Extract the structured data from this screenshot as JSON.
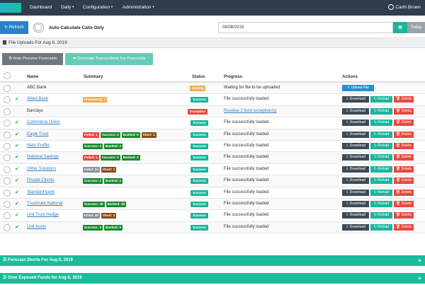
{
  "nav": {
    "items": [
      "Dashboard",
      "Daily",
      "Configuration",
      "Administration"
    ],
    "user": "Carth Brown"
  },
  "toolbar": {
    "refresh_label": "Refresh",
    "auto_calc_label": "Auto Calculate Calls Only",
    "date_value": "08/08/2019",
    "today_label": "Today"
  },
  "section": {
    "title": "File Uploads For Aug 8, 2019",
    "btn_auto": "Auto Process Forecasts",
    "btn_generate": "Generate Transactions For Forecasts"
  },
  "table": {
    "headers": [
      "Name",
      "Summary",
      "Status",
      "Progress",
      "Actions"
    ],
    "rows": [
      {
        "name": "ABC Bank",
        "link": false,
        "check": false,
        "badges": [],
        "status": "Waiting",
        "status_color": "#f0ad4e",
        "progress": "Waiting for file to be uploaded",
        "progress_link": false,
        "actions": [
          "Upload File"
        ]
      },
      {
        "name": "Allied Bank",
        "link": true,
        "check": true,
        "badges": [
          {
            "t": "Processing: 1",
            "c": "#f0ad4e"
          }
        ],
        "status": "Success",
        "status_color": "#1bb59a",
        "progress": "File successfully loaded",
        "progress_link": false,
        "actions": [
          "Download",
          "Reload",
          "Delete"
        ]
      },
      {
        "name": "Barclays",
        "link": false,
        "check": false,
        "badges": [],
        "status": "Exception",
        "status_color": "#e9483f",
        "progress": "Resolve 2 fund exception(s)",
        "progress_link": true,
        "actions": [
          "Download",
          "Reload",
          "Delete"
        ]
      },
      {
        "name": "Commerce Union",
        "link": true,
        "check": true,
        "badges": [],
        "status": "Success",
        "status_color": "#1bb59a",
        "progress": "File successfully loaded",
        "progress_link": false,
        "actions": [
          "Download",
          "Reload",
          "Delete"
        ]
      },
      {
        "name": "Eagle Trust",
        "link": true,
        "check": true,
        "badges": [
          {
            "t": "Failed: 1",
            "c": "#e9483f"
          },
          {
            "t": "Success: 5",
            "c": "#1a8a2e"
          },
          {
            "t": "Banked: 5",
            "c": "#1a8a2e"
          },
          {
            "t": "Short: 1",
            "c": "#8a4a12"
          }
        ],
        "status": "Success",
        "status_color": "#1bb59a",
        "progress": "File successfully loaded",
        "progress_link": false,
        "actions": [
          "Download",
          "Reload",
          "Delete"
        ]
      },
      {
        "name": "Main Profile",
        "link": true,
        "check": true,
        "badges": [
          {
            "t": "Success: 3",
            "c": "#1a8a2e"
          },
          {
            "t": "Banked: 3",
            "c": "#1a8a2e"
          }
        ],
        "status": "Success",
        "status_color": "#1bb59a",
        "progress": "File successfully loaded",
        "progress_link": false,
        "actions": [
          "Download",
          "Reload",
          "Delete"
        ]
      },
      {
        "name": "National Savings",
        "link": true,
        "check": true,
        "badges": [
          {
            "t": "Failed: 1",
            "c": "#e9483f"
          },
          {
            "t": "Success: 2",
            "c": "#1a8a2e"
          },
          {
            "t": "Banked: 2",
            "c": "#1a8a2e"
          }
        ],
        "status": "Success",
        "status_color": "#1bb59a",
        "progress": "File successfully loaded",
        "progress_link": false,
        "actions": [
          "Download",
          "Reload",
          "Delete"
        ]
      },
      {
        "name": "Other Solutions",
        "link": true,
        "check": true,
        "badges": [
          {
            "t": "Initial: 22",
            "c": "#8a9196"
          },
          {
            "t": "Short: 1",
            "c": "#8a4a12"
          }
        ],
        "status": "Success",
        "status_color": "#1bb59a",
        "progress": "File successfully loaded",
        "progress_link": false,
        "actions": [
          "Download",
          "Reload",
          "Delete"
        ]
      },
      {
        "name": "Private Clients",
        "link": true,
        "check": true,
        "badges": [
          {
            "t": "Success: 2",
            "c": "#1a8a2e"
          },
          {
            "t": "Banked: 2",
            "c": "#1a8a2e"
          }
        ],
        "status": "Success",
        "status_color": "#1bb59a",
        "progress": "File successfully loaded",
        "progress_link": false,
        "actions": [
          "Download",
          "Reload",
          "Delete"
        ]
      },
      {
        "name": "Standard bank",
        "link": true,
        "check": true,
        "badges": [],
        "status": "Success",
        "status_color": "#1bb59a",
        "progress": "File successfully loaded",
        "progress_link": false,
        "actions": [
          "Download",
          "Reload",
          "Delete"
        ]
      },
      {
        "name": "Trustmark National",
        "link": true,
        "check": true,
        "badges": [
          {
            "t": "Success: 28",
            "c": "#1a8a2e"
          },
          {
            "t": "Banked: 28",
            "c": "#1a8a2e"
          }
        ],
        "status": "Success",
        "status_color": "#1bb59a",
        "progress": "File successfully loaded",
        "progress_link": false,
        "actions": [
          "Download",
          "Reload",
          "Delete"
        ]
      },
      {
        "name": "Unit Trust Hedge",
        "link": true,
        "check": true,
        "badges": [
          {
            "t": "Initial: 26",
            "c": "#8a9196"
          },
          {
            "t": "Short: 2",
            "c": "#8a4a12"
          }
        ],
        "status": "Success",
        "status_color": "#1bb59a",
        "progress": "File successfully loaded",
        "progress_link": false,
        "actions": [
          "Download",
          "Reload",
          "Delete"
        ]
      },
      {
        "name": "Unit trusts",
        "link": true,
        "check": true,
        "badges": [
          {
            "t": "Success: 9",
            "c": "#1a8a2e"
          },
          {
            "t": "Banked: 9",
            "c": "#1a8a2e"
          }
        ],
        "status": "Success",
        "status_color": "#1bb59a",
        "progress": "File successfully loaded",
        "progress_link": false,
        "actions": [
          "Download",
          "Reload",
          "Delete"
        ]
      }
    ]
  },
  "panels": [
    {
      "title": "Forecast Shorts For Aug 8, 2019"
    },
    {
      "title": "Over Exposed Funds for Aug 8, 2019"
    }
  ]
}
